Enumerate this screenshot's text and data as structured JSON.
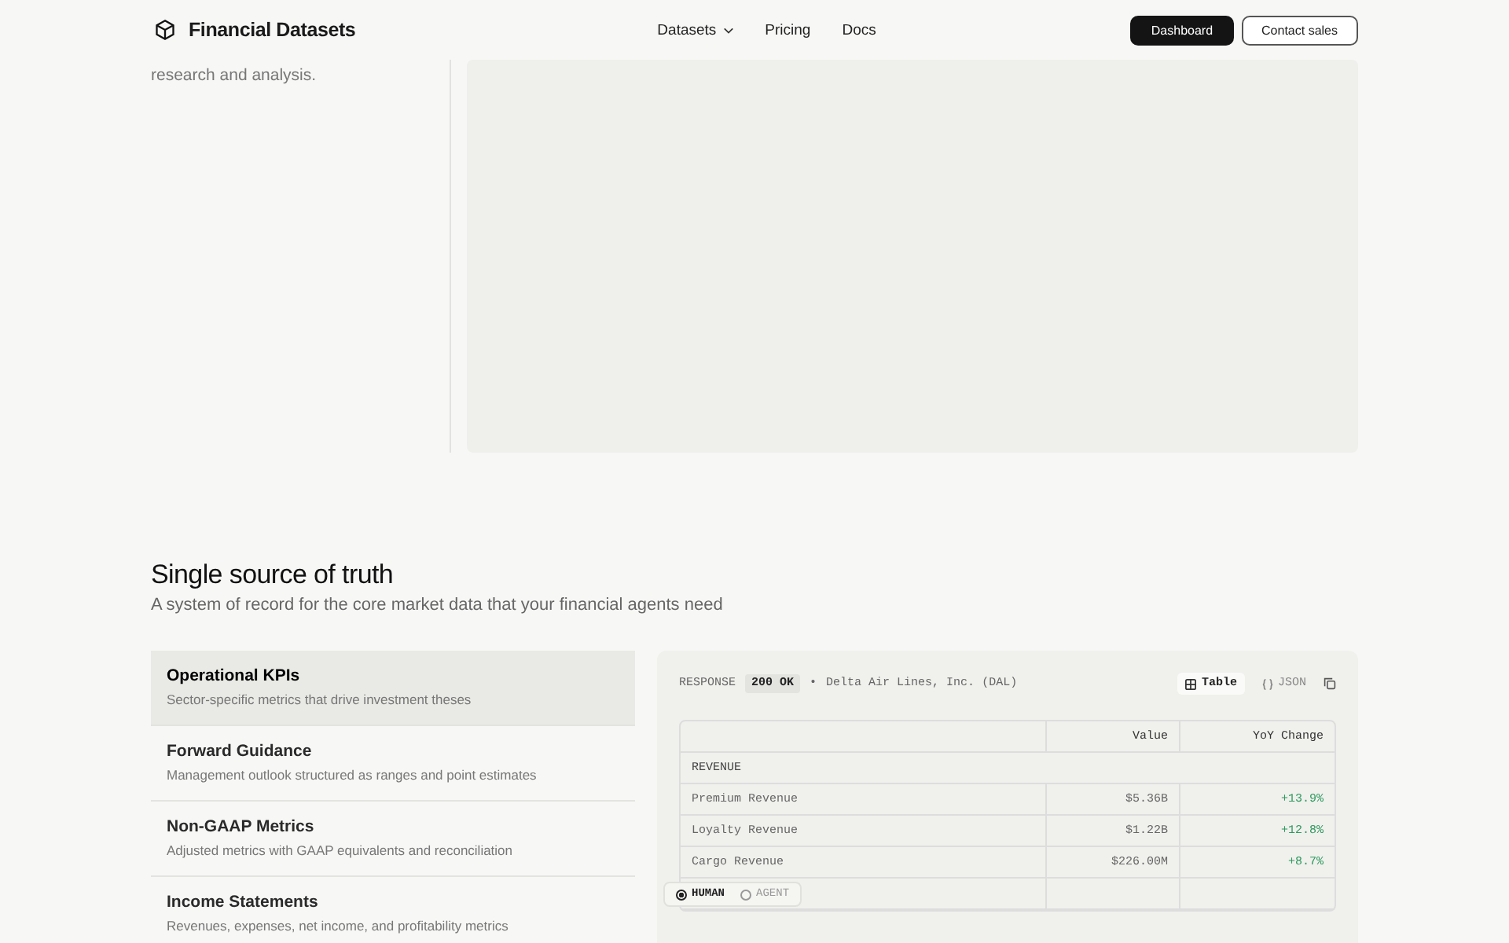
{
  "header": {
    "brand": "Financial Datasets",
    "nav": [
      {
        "label": "Datasets",
        "dropdown": true
      },
      {
        "label": "Pricing",
        "dropdown": false
      },
      {
        "label": "Docs",
        "dropdown": false
      }
    ],
    "buttons": [
      {
        "label": "Dashboard",
        "kind": "primary"
      },
      {
        "label": "Contact sales",
        "kind": "secondary"
      }
    ]
  },
  "hero": {
    "text": "research and analysis."
  },
  "section": {
    "title": "Single source of truth",
    "subtitle": "A system of record for the core market data that your financial agents need"
  },
  "features": [
    {
      "title": "Operational KPIs",
      "description": "Sector-specific metrics that drive investment theses",
      "selected": true
    },
    {
      "title": "Forward Guidance",
      "description": "Management outlook structured as ranges and point estimates",
      "selected": false
    },
    {
      "title": "Non-GAAP Metrics",
      "description": "Adjusted metrics with GAAP equivalents and reconciliation",
      "selected": false
    },
    {
      "title": "Income Statements",
      "description": "Revenues, expenses, net income, and profitability metrics",
      "selected": false
    }
  ],
  "response": {
    "label": "RESPONSE",
    "status": "200 OK",
    "separator": "•",
    "company": "Delta Air Lines, Inc. (DAL)",
    "views": [
      {
        "label": "Table",
        "kind": "table",
        "selected": true
      },
      {
        "label": "JSON",
        "kind": "json",
        "selected": false
      }
    ],
    "columns": [
      "Value",
      "YoY Change"
    ],
    "rows": [
      {
        "kind": "group",
        "label": "REVENUE"
      },
      {
        "kind": "data",
        "label": "Premium Revenue",
        "value": "$5.36B",
        "change": "+13.9%"
      },
      {
        "kind": "data",
        "label": "Loyalty Revenue",
        "value": "$1.22B",
        "change": "+12.8%"
      },
      {
        "kind": "data",
        "label": "Cargo Revenue",
        "value": "$226.00M",
        "change": "+8.7%"
      },
      {
        "kind": "blank"
      }
    ],
    "modes": [
      {
        "label": "HUMAN",
        "selected": true
      },
      {
        "label": "AGENT",
        "selected": false
      }
    ]
  }
}
